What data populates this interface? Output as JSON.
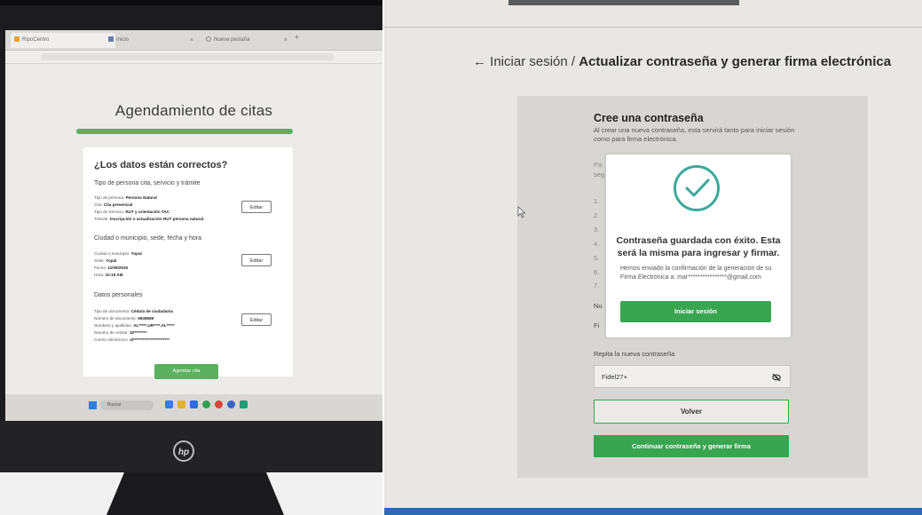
{
  "left_photo": {
    "browser": {
      "tabs": [
        {
          "label": "RipoCentro"
        },
        {
          "label": "Inicio"
        },
        {
          "label": "Nueva pestaña"
        }
      ]
    },
    "page": {
      "title": "Agendamiento de citas",
      "card_title": "¿Los datos están correctos?",
      "section1": {
        "heading": "Tipo de persona cita, servicio y trámite",
        "rows": [
          {
            "label": "Tipo de persona:",
            "value": "Persona Natural"
          },
          {
            "label": "Cita:",
            "value": "Cita presencial"
          },
          {
            "label": "Tipo de Servicio:",
            "value": "RUT y orientación TAC"
          },
          {
            "label": "Trámite:",
            "value": "Inscripción o actualización RUT persona natural."
          }
        ],
        "edit_label": "Editar"
      },
      "section2": {
        "heading": "Ciudad o municipio, sede, fecha y hora",
        "rows": [
          {
            "label": "Ciudad o municipio:",
            "value": "Yopal"
          },
          {
            "label": "Sede:",
            "value": "Yopal"
          },
          {
            "label": "Fecha:",
            "value": "11/09/2025"
          },
          {
            "label": "Hora:",
            "value": "10:15 AM"
          }
        ],
        "edit_label": "Editar"
      },
      "section3": {
        "heading": "Datos personales",
        "rows": [
          {
            "label": "Tipo de documento:",
            "value": "Cédula de ciudadanía"
          },
          {
            "label": "Número de documento:",
            "value": "9638589"
          },
          {
            "label": "Nombres y apellidos:",
            "value": "AL*****,UR****,AL*****"
          },
          {
            "label": "Número de celular:",
            "value": "32********"
          },
          {
            "label": "Correo electrónico:",
            "value": "al***********************"
          }
        ],
        "edit_label": "Editar"
      },
      "submit_label": "Agendar cita"
    },
    "taskbar": {
      "search_label": "Buscar"
    },
    "brand": "hp"
  },
  "right_photo": {
    "breadcrumb": {
      "arrow": "←",
      "link": "Iniciar sesión",
      "separator": "/",
      "current": "Actualizar contraseña y generar firma electrónica"
    },
    "form": {
      "title": "Cree una contraseña",
      "subtitle": "Al crear una nueva contraseña, esta servirá tanto para iniciar sesión como para firma electrónica.",
      "faded_fragments": [
        "Pa",
        "seg",
        "1.",
        "2.",
        "3.",
        "4.",
        "5.",
        "6.",
        "7.",
        "Nu",
        "Fi"
      ],
      "repeat_label": "Repita la nueva contraseña",
      "repeat_value": "Fidel27+",
      "back_label": "Volver",
      "continue_label": "Continuar contraseña y generar firma"
    },
    "modal": {
      "title": "Contraseña guardada con éxito. Esta será la misma para ingresar y firmar.",
      "message": "Hemos enviado la confirmación de la generación de su Firma Electrónica a: mar****************@gmail.com",
      "button_label": "Iniciar sesión",
      "accent_color": "#3ba89a"
    },
    "colors": {
      "primary_green": "#39a551"
    }
  }
}
